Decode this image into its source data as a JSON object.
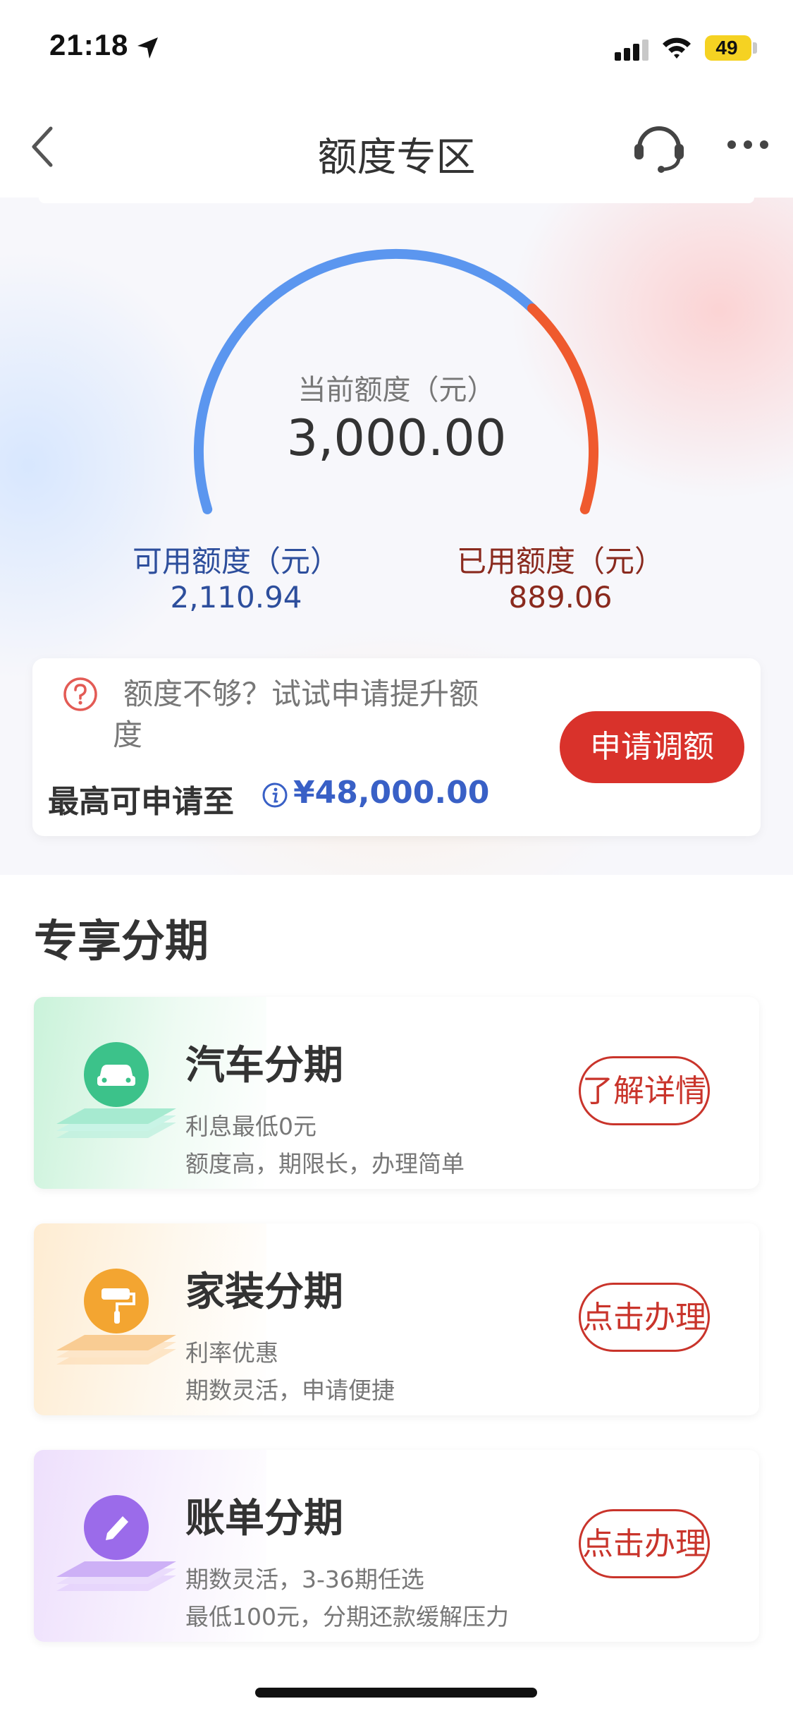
{
  "status_bar": {
    "time": "21:18",
    "battery": "49"
  },
  "nav": {
    "title": "额度专区"
  },
  "credit": {
    "current_label": "当前额度（元）",
    "current_value": "3,000.00",
    "available_label": "可用额度（元）",
    "available_value": "2,110.94",
    "used_label": "已用额度（元）",
    "used_value": "889.06",
    "used_fraction": 0.2964
  },
  "limit_card": {
    "hint_line1": "额度不够？试试申请提升额",
    "hint_line2": "度",
    "max_label": "最高可申请至",
    "max_amount": "¥48,000.00",
    "apply_button": "申请调额"
  },
  "section": {
    "title": "专享分期"
  },
  "products": [
    {
      "title": "汽车分期",
      "line1": "利息最低0元",
      "line2": "额度高，期限长，办理简单",
      "button": "了解详情",
      "icon": "car-icon"
    },
    {
      "title": "家装分期",
      "line1": "利率优惠",
      "line2": "期数灵活，申请便捷",
      "button": "点击办理",
      "icon": "paint-roller-icon"
    },
    {
      "title": "账单分期",
      "line1": "期数灵活，3-36期任选",
      "line2": "最低100元，分期还款缓解压力",
      "button": "点击办理",
      "icon": "pencil-icon"
    }
  ],
  "colors": {
    "accent_red": "#d9322b",
    "gauge_blue": "#5b96ef",
    "gauge_orange": "#ef5a2e",
    "amount_blue": "#3960c6"
  }
}
